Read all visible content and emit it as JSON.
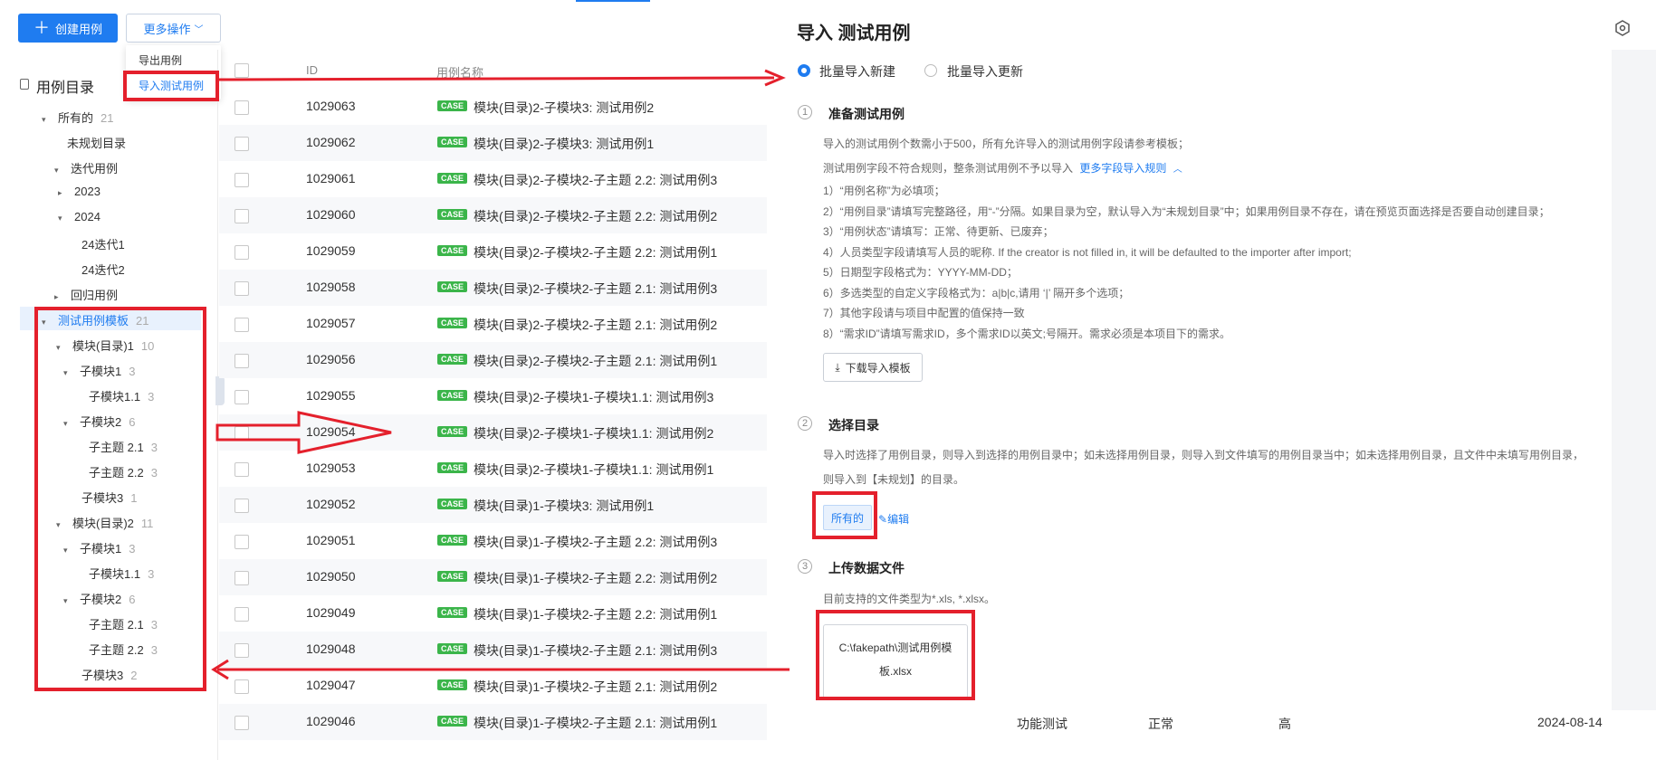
{
  "toolbar": {
    "create_label": "创建用例",
    "more_label": "更多操作",
    "menu_items": [
      "导出用例",
      "导入测试用例"
    ]
  },
  "sidebar": {
    "title": "用例目录",
    "items": [
      {
        "label": "所有的",
        "count": "21"
      },
      {
        "label": "未规划目录",
        "count": ""
      },
      {
        "label": "迭代用例",
        "count": ""
      },
      {
        "label": "2023",
        "count": ""
      },
      {
        "label": "2024",
        "count": ""
      },
      {
        "label": "24迭代1",
        "count": ""
      },
      {
        "label": "24迭代2",
        "count": ""
      },
      {
        "label": "回归用例",
        "count": ""
      },
      {
        "label": "测试用例模板",
        "count": "21"
      },
      {
        "label": "模块(目录)1",
        "count": "10"
      },
      {
        "label": "子模块1",
        "count": "3"
      },
      {
        "label": "子模块1.1",
        "count": "3"
      },
      {
        "label": "子模块2",
        "count": "6"
      },
      {
        "label": "子主题 2.1",
        "count": "3"
      },
      {
        "label": "子主题 2.2",
        "count": "3"
      },
      {
        "label": "子模块3",
        "count": "1"
      },
      {
        "label": "模块(目录)2",
        "count": "11"
      },
      {
        "label": "子模块1",
        "count": "3"
      },
      {
        "label": "子模块1.1",
        "count": "3"
      },
      {
        "label": "子模块2",
        "count": "6"
      },
      {
        "label": "子主题 2.1",
        "count": "3"
      },
      {
        "label": "子主题 2.2",
        "count": "3"
      },
      {
        "label": "子模块3",
        "count": "2"
      }
    ]
  },
  "table": {
    "headers": {
      "id": "ID",
      "name": "用例名称"
    },
    "tag": "CASE",
    "rows": [
      {
        "id": "1029063",
        "name": "模块(目录)2-子模块3: 测试用例2"
      },
      {
        "id": "1029062",
        "name": "模块(目录)2-子模块3: 测试用例1"
      },
      {
        "id": "1029061",
        "name": "模块(目录)2-子模块2-子主题 2.2: 测试用例3"
      },
      {
        "id": "1029060",
        "name": "模块(目录)2-子模块2-子主题 2.2: 测试用例2"
      },
      {
        "id": "1029059",
        "name": "模块(目录)2-子模块2-子主题 2.2: 测试用例1"
      },
      {
        "id": "1029058",
        "name": "模块(目录)2-子模块2-子主题 2.1: 测试用例3"
      },
      {
        "id": "1029057",
        "name": "模块(目录)2-子模块2-子主题 2.1: 测试用例2"
      },
      {
        "id": "1029056",
        "name": "模块(目录)2-子模块2-子主题 2.1: 测试用例1"
      },
      {
        "id": "1029055",
        "name": "模块(目录)2-子模块1-子模块1.1: 测试用例3"
      },
      {
        "id": "1029054",
        "name": "模块(目录)2-子模块1-子模块1.1: 测试用例2"
      },
      {
        "id": "1029053",
        "name": "模块(目录)2-子模块1-子模块1.1: 测试用例1"
      },
      {
        "id": "1029052",
        "name": "模块(目录)1-子模块3: 测试用例1"
      },
      {
        "id": "1029051",
        "name": "模块(目录)1-子模块2-子主题 2.2: 测试用例3"
      },
      {
        "id": "1029050",
        "name": "模块(目录)1-子模块2-子主题 2.2: 测试用例2"
      },
      {
        "id": "1029049",
        "name": "模块(目录)1-子模块2-子主题 2.2: 测试用例1"
      },
      {
        "id": "1029048",
        "name": "模块(目录)1-子模块2-子主题 2.1: 测试用例3"
      },
      {
        "id": "1029047",
        "name": "模块(目录)1-子模块2-子主题 2.1: 测试用例2"
      },
      {
        "id": "1029046",
        "name": "模块(目录)1-子模块2-子主题 2.1: 测试用例1"
      }
    ],
    "last_row_extra": {
      "type": "功能测试",
      "status": "正常",
      "priority": "高",
      "date": "2024-08-14"
    }
  },
  "panel": {
    "title": "导入 测试用例",
    "mode_options": [
      "批量导入新建",
      "批量导入更新"
    ],
    "step1": {
      "number": "1",
      "title": "准备测试用例",
      "desc1": "导入的测试用例个数需小于500，所有允许导入的测试用例字段请参考模板；",
      "desc2": "测试用例字段不符合规则，整条测试用例不予以导入",
      "rules_link": "更多字段导入规则",
      "rules": [
        "1）“用例名称”为必填项；",
        "2）“用例目录”请填写完整路径，用“-”分隔。如果目录为空，默认导入为“未规划目录”中；如果用例目录不存在，请在预览页面选择是否要自动创建目录；",
        "3）“用例状态”请填写：正常、待更新、已废弃；",
        "4）人员类型字段请填写人员的昵称. If the creator is not filled in, it will be defaulted to the importer after import;",
        "5）日期型字段格式为：YYYY-MM-DD；",
        "6）多选类型的自定义字段格式为：a|b|c,请用 ‘|’ 隔开多个选项；",
        "7）其他字段请与项目中配置的值保持一致",
        "8）“需求ID”请填写需求ID，多个需求ID以英文;号隔开。需求必须是本项目下的需求。"
      ],
      "download_label": "下载导入模板"
    },
    "step2": {
      "number": "2",
      "title": "选择目录",
      "desc1": "导入时选择了用例目录，则导入到选择的用例目录中；如未选择用例目录，则导入到文件填写的用例目录当中；如未选择用例目录，且文件中未填写用例目录，",
      "desc2": "则导入到【未规划】的目录。",
      "chip": "所有的",
      "edit": "编辑"
    },
    "step3": {
      "number": "3",
      "title": "上传数据文件",
      "desc": "目前支持的文件类型为*.xls, *.xlsx。",
      "file_line1": "C:\\fakepath\\测试用例模",
      "file_line2": "板.xlsx"
    }
  },
  "colors": {
    "primary": "#1f7cf0",
    "highlight": "#e4202c",
    "case_tag": "#3bb54a"
  }
}
